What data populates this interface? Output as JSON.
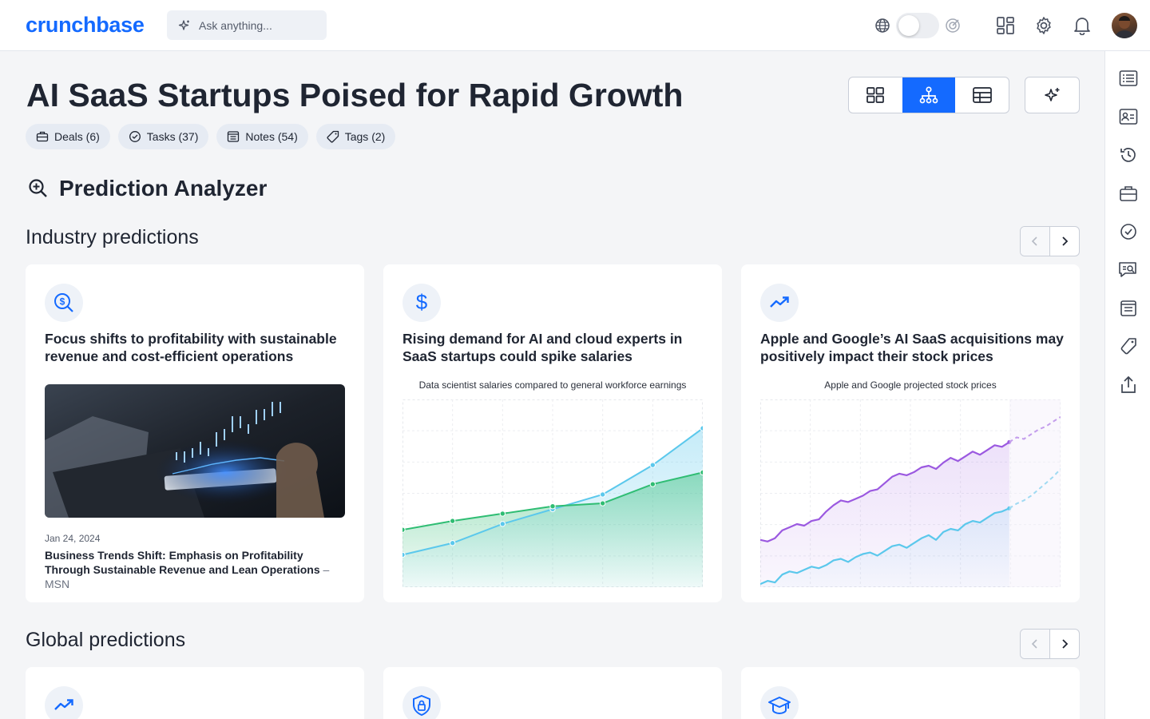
{
  "app": {
    "logo": "crunchbase"
  },
  "search": {
    "placeholder": "Ask anything..."
  },
  "header": {
    "title": "AI SaaS Startups Poised for Rapid Growth",
    "chips": [
      {
        "label": "Deals (6)",
        "icon": "briefcase-icon"
      },
      {
        "label": "Tasks (37)",
        "icon": "check-circle-icon"
      },
      {
        "label": "Notes (54)",
        "icon": "note-icon"
      },
      {
        "label": "Tags (2)",
        "icon": "tag-icon"
      }
    ],
    "active_view": "hierarchy"
  },
  "analyzer": {
    "title": "Prediction Analyzer"
  },
  "industry": {
    "title": "Industry predictions",
    "cards": [
      {
        "icon": "dollar-search-icon",
        "title": "Focus shifts to profitability with sustainable revenue and cost-efficient operations",
        "date": "Jan 24, 2024",
        "article": "Business Trends Shift: Emphasis on Profitability Through Sustainable Revenue and Lean Operations",
        "source": "– MSN"
      },
      {
        "icon": "dollar-icon",
        "title": "Rising demand for AI and cloud experts in SaaS startups could spike salaries",
        "caption": "Data scientist salaries compared to general workforce earnings"
      },
      {
        "icon": "trending-up-icon",
        "title": "Apple and Google’s AI SaaS acquisitions may positively impact their stock prices",
        "caption": "Apple and Google projected stock prices"
      }
    ]
  },
  "global": {
    "title": "Global predictions",
    "cards": [
      {
        "icon": "trending-up-icon"
      },
      {
        "icon": "shield-lock-icon"
      },
      {
        "icon": "graduation-cap-icon"
      }
    ]
  },
  "colors": {
    "accent": "#146aff",
    "series_blue": "#5bc8ec",
    "series_green": "#2fbd73",
    "series_purple": "#9b59e0",
    "series_light_blue": "#5bc8ec"
  },
  "chart_data": [
    {
      "type": "line",
      "title": "Data scientist salaries compared to general workforce earnings",
      "x": [
        1,
        2,
        3,
        4,
        5,
        6,
        7
      ],
      "series": [
        {
          "values": [
            22,
            30,
            43,
            53,
            63,
            83,
            108
          ],
          "color": "#5bc8ec"
        },
        {
          "values": [
            39,
            45,
            50,
            55,
            57,
            70,
            78
          ],
          "color": "#2fbd73"
        }
      ],
      "ylim": [
        0,
        120
      ],
      "grid": true
    },
    {
      "type": "line",
      "title": "Apple and Google projected stock prices",
      "series": [
        {
          "color": "#9b59e0",
          "values": [
            30,
            29,
            31,
            36,
            38,
            40,
            39,
            42,
            43,
            48,
            52,
            55,
            54,
            56,
            58,
            61,
            62,
            66,
            70,
            72,
            71,
            73,
            76,
            77,
            75,
            79,
            82,
            80,
            83,
            86,
            84,
            87,
            90,
            89,
            92,
            95,
            94,
            97,
            100,
            102,
            105,
            108
          ],
          "projected_from_index": 34
        },
        {
          "color": "#5bc8ec",
          "values": [
            2,
            4,
            3,
            8,
            10,
            9,
            11,
            13,
            12,
            14,
            17,
            18,
            16,
            19,
            21,
            22,
            20,
            23,
            26,
            27,
            25,
            28,
            31,
            33,
            30,
            35,
            37,
            36,
            40,
            42,
            41,
            44,
            47,
            48,
            50,
            53,
            55,
            58,
            62,
            66,
            70,
            75
          ],
          "projected_from_index": 34
        }
      ],
      "ylim": [
        0,
        115
      ],
      "grid": true
    }
  ]
}
